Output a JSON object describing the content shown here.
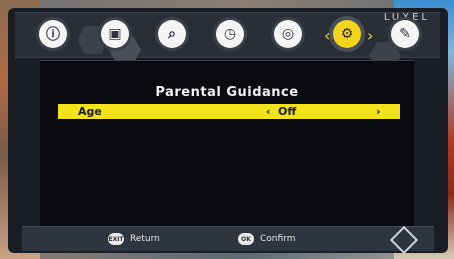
{
  "brand": "LUXEL",
  "menu": {
    "active_index": 5,
    "items": [
      {
        "icon": "info-icon"
      },
      {
        "icon": "picture-icon"
      },
      {
        "icon": "search-icon"
      },
      {
        "icon": "clock-icon"
      },
      {
        "icon": "globe-icon"
      },
      {
        "icon": "settings-gear-icon"
      },
      {
        "icon": "tools-icon"
      }
    ]
  },
  "panel": {
    "title": "Parental Guidance",
    "setting": {
      "label": "Age",
      "left_arrow": "‹",
      "value": "Off",
      "right_arrow": "›"
    }
  },
  "bottom_bar": {
    "return_key": "EXIT",
    "return_label": "Return",
    "confirm_key": "OK",
    "confirm_label": "Confirm"
  },
  "colors": {
    "accent": "#f3e31a",
    "background": "#090b10",
    "menu_strip": "#2a2e36"
  }
}
